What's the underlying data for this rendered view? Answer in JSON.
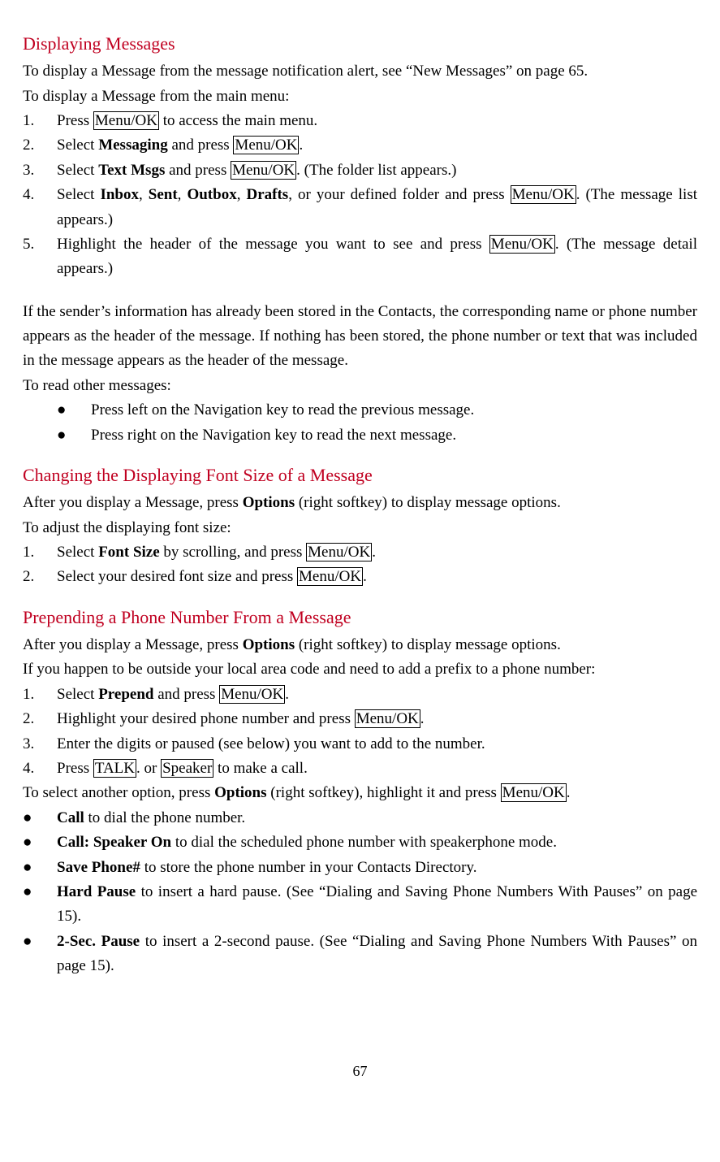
{
  "section1": {
    "heading": "Displaying Messages",
    "p1": "To display a Message from the message notification alert, see “New Messages” on page 65.",
    "p2": "To display a Message from the main menu:",
    "steps": {
      "s1": {
        "num": "1.",
        "pre": "Press ",
        "box1": "Menu/OK",
        "post": " to access the main menu."
      },
      "s2": {
        "num": "2.",
        "pre": "Select ",
        "bold1": "Messaging",
        "mid": " and press ",
        "box1": "Menu/OK",
        "post": "."
      },
      "s3": {
        "num": "3.",
        "pre": "Select ",
        "bold1": "Text Msgs",
        "mid": " and press ",
        "box1": "Menu/OK",
        "post": ". (The folder list appears.)"
      },
      "s4": {
        "num": "4.",
        "pre": "Select ",
        "bold1": "Inbox",
        "c1": ", ",
        "bold2": "Sent",
        "c2": ", ",
        "bold3": "Outbox",
        "c3": ", ",
        "bold4": "Drafts",
        "mid": ", or your defined folder and press ",
        "box1": "Menu/OK",
        "post": ". (The message list appears.)"
      },
      "s5": {
        "num": "5.",
        "pre": "Highlight the header of the message you want to see and press ",
        "box1": "Menu/OK",
        "post": ". (The message detail appears.)"
      }
    },
    "p3": "If the sender’s information has already been stored in the Contacts, the corresponding name or phone number appears as the header of the message. If nothing has been stored, the phone number or text that was included in the message appears as the header of the message.",
    "p4": "To read other messages:",
    "bullets": {
      "b1": "Press left on the Navigation key to read the previous message.",
      "b2": "Press right on the Navigation key to read the next message."
    }
  },
  "section2": {
    "heading": "Changing the Displaying Font Size of a Message",
    "p1_pre": "After you display a Message, press ",
    "p1_bold": "Options",
    "p1_post": " (right softkey) to display message options.",
    "p2": "To adjust the displaying font size:",
    "steps": {
      "s1": {
        "num": "1.",
        "pre": "Select ",
        "bold1": "Font Size",
        "mid": " by scrolling, and press ",
        "box1": "Menu/OK",
        "post": "."
      },
      "s2": {
        "num": "2.",
        "pre": "Select your desired font size and press ",
        "box1": "Menu/OK",
        "post": "."
      }
    }
  },
  "section3": {
    "heading": "Prepending a Phone Number From a Message",
    "p1_pre": "After you display a Message, press ",
    "p1_bold": "Options",
    "p1_post": " (right softkey) to display message options.",
    "p2": "If you happen to be outside your local area code and need to add a prefix to a phone number:",
    "steps": {
      "s1": {
        "num": "1.",
        "pre": "Select ",
        "bold1": "Prepend",
        "mid": " and press ",
        "box1": "Menu/OK",
        "post": "."
      },
      "s2": {
        "num": "2.",
        "pre": "Highlight your desired phone number and press ",
        "box1": "Menu/OK",
        "post": "."
      },
      "s3": {
        "num": "3.",
        "text": "Enter the digits or paused (see below) you want to add to the number."
      },
      "s4": {
        "num": "4.",
        "pre": "Press ",
        "box1": "TALK",
        "mid": ". or ",
        "box2": "Speaker",
        "post": " to make a call."
      }
    },
    "p3_pre": "To select another option, press ",
    "p3_bold": "Options",
    "p3_mid": " (right softkey), highlight it and press ",
    "p3_box": "Menu/OK",
    "p3_post": ".",
    "bullets": {
      "b1": {
        "bold": "Call",
        "text": " to dial the phone number."
      },
      "b2": {
        "bold": "Call: Speaker On",
        "text": " to dial the scheduled phone number with speakerphone mode."
      },
      "b3": {
        "bold": "Save Phone#",
        "text": " to store the phone number in your Contacts Directory."
      },
      "b4": {
        "bold": "Hard Pause",
        "text": " to insert a hard pause. (See “Dialing and Saving Phone Numbers With Pauses” on page 15)."
      },
      "b5": {
        "bold": "2-Sec. Pause",
        "text": " to insert a 2-second pause. (See “Dialing and Saving Phone Numbers With Pauses” on page 15)."
      }
    }
  },
  "pageNum": "67",
  "bulletChar": "●"
}
